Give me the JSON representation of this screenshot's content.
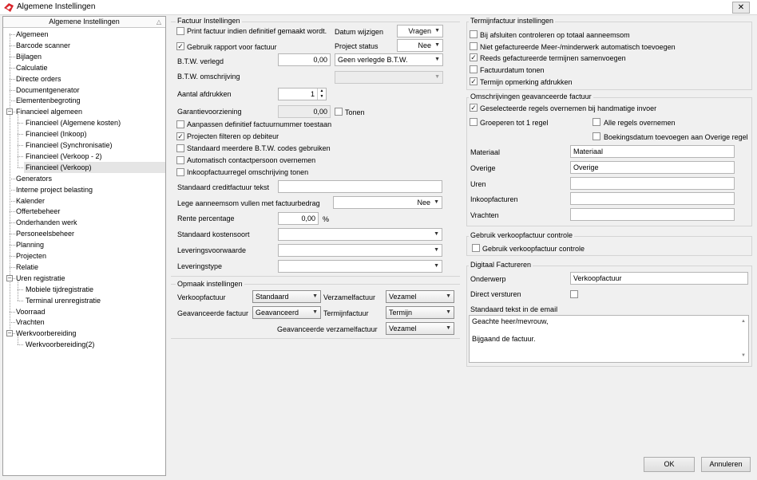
{
  "window": {
    "title": "Algemene Instellingen",
    "close_glyph": "✕",
    "icon": "app-logo-icon",
    "accent_color": "#d9242a"
  },
  "sidebar": {
    "header": "Algemene Instellingen",
    "sort_glyph": "△",
    "items": [
      {
        "label": "Algemeen"
      },
      {
        "label": "Barcode scanner"
      },
      {
        "label": "Bijlagen"
      },
      {
        "label": "Calculatie"
      },
      {
        "label": "Directe orders"
      },
      {
        "label": "Documentgenerator"
      },
      {
        "label": "Elementenbegroting"
      },
      {
        "label": "Financieel algemeen"
      },
      {
        "label": "Financieel (Algemene kosten)"
      },
      {
        "label": "Financieel (Inkoop)"
      },
      {
        "label": "Financieel (Synchronisatie)"
      },
      {
        "label": "Financieel (Verkoop - 2)"
      },
      {
        "label": "Financieel (Verkoop)"
      },
      {
        "label": "Generators"
      },
      {
        "label": "Interne project belasting"
      },
      {
        "label": "Kalender"
      },
      {
        "label": "Offertebeheer"
      },
      {
        "label": "Onderhanden werk"
      },
      {
        "label": "Personeelsbeheer"
      },
      {
        "label": "Planning"
      },
      {
        "label": "Projecten"
      },
      {
        "label": "Relatie"
      },
      {
        "label": "Uren registratie"
      },
      {
        "label": "Mobiele tijdregistratie"
      },
      {
        "label": "Terminal urenregistratie"
      },
      {
        "label": "Voorraad"
      },
      {
        "label": "Vrachten"
      },
      {
        "label": "Werkvoorbereiding"
      },
      {
        "label": "Werkvoorbereiding(2)"
      }
    ],
    "collapse_glyph": "−"
  },
  "factuur": {
    "legend": "Factuur Instellingen",
    "print_definitief": {
      "label": "Print factuur indien definitief gemaakt wordt.",
      "checked": false
    },
    "datum_wijzigen": {
      "label": "Datum wijzigen",
      "value": "Vragen"
    },
    "gebruik_rapport": {
      "label": "Gebruik rapport voor factuur",
      "checked": true
    },
    "project_status": {
      "label": "Project status",
      "value": "Nee"
    },
    "btw_verlegd": {
      "label": "B.T.W. verlegd",
      "value": "0,00",
      "select": "Geen verlegde B.T.W."
    },
    "btw_omschrijving": {
      "label": "B.T.W. omschrijving",
      "value": ""
    },
    "aantal_afdrukken": {
      "label": "Aantal afdrukken",
      "value": "1"
    },
    "garantievoorziening": {
      "label": "Garantievoorziening",
      "value": "0,00"
    },
    "tonen": {
      "label": "Tonen",
      "checked": false
    },
    "checks": [
      {
        "label": "Aanpassen definitief factuurnummer toestaan",
        "checked": false
      },
      {
        "label": "Projecten filteren op debiteur",
        "checked": true
      },
      {
        "label": "Standaard meerdere B.T.W. codes gebruiken",
        "checked": false
      },
      {
        "label": "Automatisch contactpersoon overnemen",
        "checked": false
      },
      {
        "label": "Inkoopfactuurregel omschrijving tonen",
        "checked": false
      }
    ],
    "creditfactuur_tekst": {
      "label": "Standaard creditfactuur tekst",
      "value": ""
    },
    "lege_aanneemsom": {
      "label": "Lege aanneemsom vullen met factuurbedrag",
      "value": "Nee"
    },
    "rente": {
      "label": "Rente percentage",
      "value": "0,00",
      "unit": "%"
    },
    "kostensoort": {
      "label": "Standaard kostensoort",
      "value": ""
    },
    "leveringsvoorwaarde": {
      "label": "Leveringsvoorwaarde",
      "value": ""
    },
    "leveringstype": {
      "label": "Leveringstype",
      "value": ""
    }
  },
  "opmaak": {
    "legend": "Opmaak instellingen",
    "verkoopfactuur": {
      "label": "Verkoopfactuur",
      "value": "Standaard"
    },
    "verzamelfactuur": {
      "label": "Verzamelfactuur",
      "value": "Vezamel"
    },
    "geavanceerde_factuur": {
      "label": "Geavanceerde factuur",
      "value": "Geavanceerd"
    },
    "termijnfactuur": {
      "label": "Termijnfactuur",
      "value": "Termijn"
    },
    "geav_verzamelfactuur": {
      "label": "Geavanceerde verzamelfactuur",
      "value": "Vezamel"
    }
  },
  "termijn": {
    "legend": "Termijnfactuur instellingen",
    "checks": [
      {
        "label": "Bij afsluiten controleren op totaal aanneemsom",
        "checked": false
      },
      {
        "label": "Niet gefactureerde Meer-/minderwerk automatisch toevoegen",
        "checked": false
      },
      {
        "label": "Reeds gefactureerde termijnen samenvoegen",
        "checked": true
      },
      {
        "label": "Factuurdatum tonen",
        "checked": false
      },
      {
        "label": "Termijn opmerking afdrukken",
        "checked": true
      }
    ]
  },
  "omschrijvingen": {
    "legend": "Omschrijvingen geavanceerde factuur",
    "geselecteerde": {
      "label": "Geselecteerde regels overnemen bij handmatige invoer",
      "checked": true
    },
    "groeperen": {
      "label": "Groeperen tot 1 regel",
      "checked": false
    },
    "alle_regels": {
      "label": "Alle regels overnemen",
      "checked": false
    },
    "boekingsdatum": {
      "label": "Boekingsdatum toevoegen aan Overige regel",
      "checked": false
    },
    "fields": [
      {
        "label": "Materiaal",
        "value": "Materiaal"
      },
      {
        "label": "Overige",
        "value": "Overige"
      },
      {
        "label": "Uren",
        "value": ""
      },
      {
        "label": "Inkoopfacturen",
        "value": ""
      },
      {
        "label": "Vrachten",
        "value": ""
      }
    ]
  },
  "verkoop_controle": {
    "legend": "Gebruik verkoopfactuur controle",
    "check": {
      "label": "Gebruik verkoopfactuur controle",
      "checked": false
    }
  },
  "digitaal": {
    "legend": "Digitaal Factureren",
    "onderwerp": {
      "label": "Onderwerp",
      "value": "Verkoopfactuur"
    },
    "direct_versturen": {
      "label": "Direct versturen",
      "checked": false
    },
    "email_tekst": {
      "label": "Standaard tekst in de email",
      "value": "Geachte heer/mevrouw,\n\nBijgaand de factuur."
    }
  },
  "buttons": {
    "ok": "OK",
    "annuleren": "Annuleren"
  },
  "glyphs": {
    "check": "✓",
    "dropdown": "▼",
    "spin_up": "▲",
    "spin_down": "▼",
    "scroll_up": "▲",
    "scroll_down": "▼"
  }
}
